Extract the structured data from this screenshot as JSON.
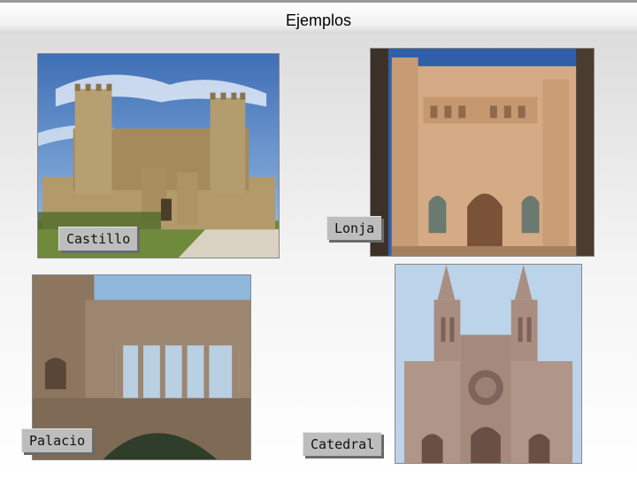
{
  "slide": {
    "title": "Ejemplos"
  },
  "photos": {
    "castillo": {
      "caption": "Castillo"
    },
    "lonja": {
      "caption": "Lonja"
    },
    "palacio": {
      "caption": "Palacio"
    },
    "catedral": {
      "caption": "Catedral"
    }
  }
}
